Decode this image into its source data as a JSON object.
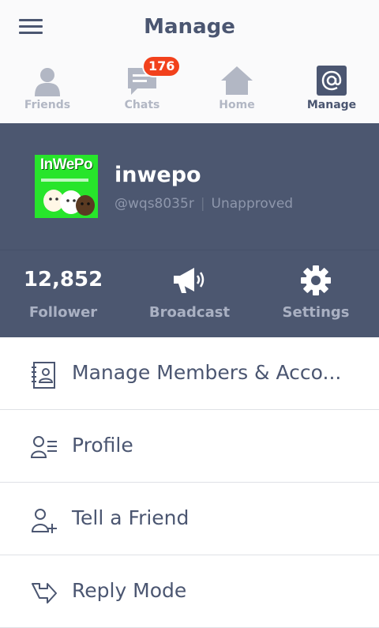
{
  "header": {
    "title": "Manage",
    "menu_icon": "hamburger-menu-icon"
  },
  "tabs": [
    {
      "label": "Friends",
      "icon": "person-icon",
      "active": false
    },
    {
      "label": "Chats",
      "icon": "chat-bubble-icon",
      "badge": "176",
      "active": false
    },
    {
      "label": "Home",
      "icon": "house-icon",
      "active": false
    },
    {
      "label": "Manage",
      "icon": "at-sign-icon",
      "active": true
    }
  ],
  "profile": {
    "avatar_text": "InWePo",
    "name": "inwepo",
    "id": "@wqs8035r",
    "status": "Unapproved"
  },
  "stats": {
    "follower_count": "12,852",
    "follower_label": "Follower",
    "broadcast_label": "Broadcast",
    "settings_label": "Settings"
  },
  "menu": [
    {
      "label": "Manage Members & Acco...",
      "icon": "member-card-icon"
    },
    {
      "label": "Profile",
      "icon": "profile-icon"
    },
    {
      "label": "Tell a Friend",
      "icon": "add-friend-icon"
    },
    {
      "label": "Reply Mode",
      "icon": "reply-arrow-icon"
    }
  ],
  "watermark": "inwepo",
  "colors": {
    "header_bg": "#4c5770",
    "badge": "#f2411c",
    "text_dark": "#4b5671",
    "tab_inactive": "#b2b7c4",
    "avatar_bg": "#27e52b"
  }
}
